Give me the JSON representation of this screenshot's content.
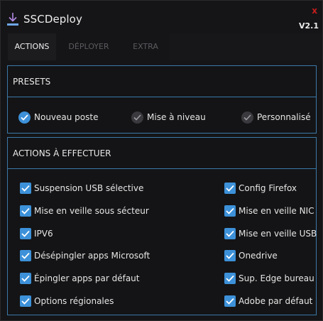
{
  "app": {
    "title": "SSCDeploy",
    "version": "V2.1",
    "close_label": "x"
  },
  "tabs": [
    {
      "label": "ACTIONS",
      "active": true
    },
    {
      "label": "DÉPLOYER",
      "active": false
    },
    {
      "label": "EXTRA",
      "active": false
    }
  ],
  "presets": {
    "header": "PRESETS",
    "options": [
      {
        "label": "Nouveau poste",
        "selected": true
      },
      {
        "label": "Mise à niveau",
        "selected": false
      },
      {
        "label": "Personnalisé",
        "selected": false
      }
    ]
  },
  "actions": {
    "header": "ACTIONS À EFFECTUER",
    "left": [
      {
        "label": "Suspension USB sélective",
        "checked": true
      },
      {
        "label": "Mise en veille sous sécteur",
        "checked": true
      },
      {
        "label": "IPV6",
        "checked": true
      },
      {
        "label": "Désépingler apps Microsoft",
        "checked": true
      },
      {
        "label": "Épingler apps par défaut",
        "checked": true
      },
      {
        "label": "Options régionales",
        "checked": true
      }
    ],
    "right": [
      {
        "label": "Config Firefox",
        "checked": true
      },
      {
        "label": "Mise en veille NIC",
        "checked": true
      },
      {
        "label": "Mise en veille USB",
        "checked": true
      },
      {
        "label": "Onedrive",
        "checked": true
      },
      {
        "label": "Sup. Edge bureau",
        "checked": true
      },
      {
        "label": "Adobe par défaut",
        "checked": true
      }
    ]
  },
  "colors": {
    "accent": "#3d91d9",
    "border": "#3b79a8",
    "close": "#c81d1d"
  }
}
